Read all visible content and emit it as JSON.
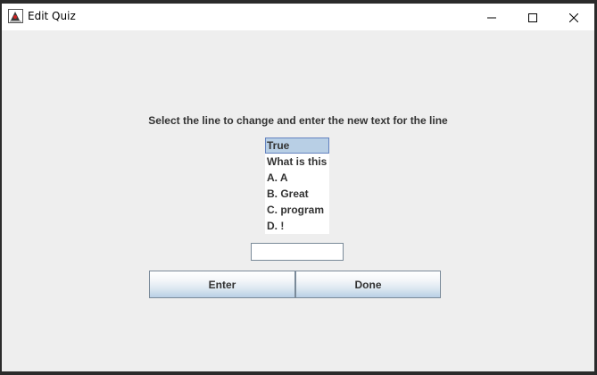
{
  "window": {
    "title": "Edit Quiz",
    "icons": {
      "app": "java-duke-icon",
      "minimize": "minimize-icon",
      "maximize": "maximize-icon",
      "close": "close-icon"
    }
  },
  "main": {
    "instruction": "Select the line to change and enter the new text for the line",
    "lines": [
      "True",
      "What is this",
      "A. A",
      "B. Great",
      "C. program",
      "D. !"
    ],
    "selected_index": 0,
    "new_text": {
      "value": "",
      "placeholder": ""
    },
    "buttons": {
      "enter": "Enter",
      "done": "Done"
    }
  },
  "colors": {
    "background": "#eeeeee",
    "selection": "#b8cfe5",
    "selection_border": "#6382bf",
    "text": "#333333"
  }
}
